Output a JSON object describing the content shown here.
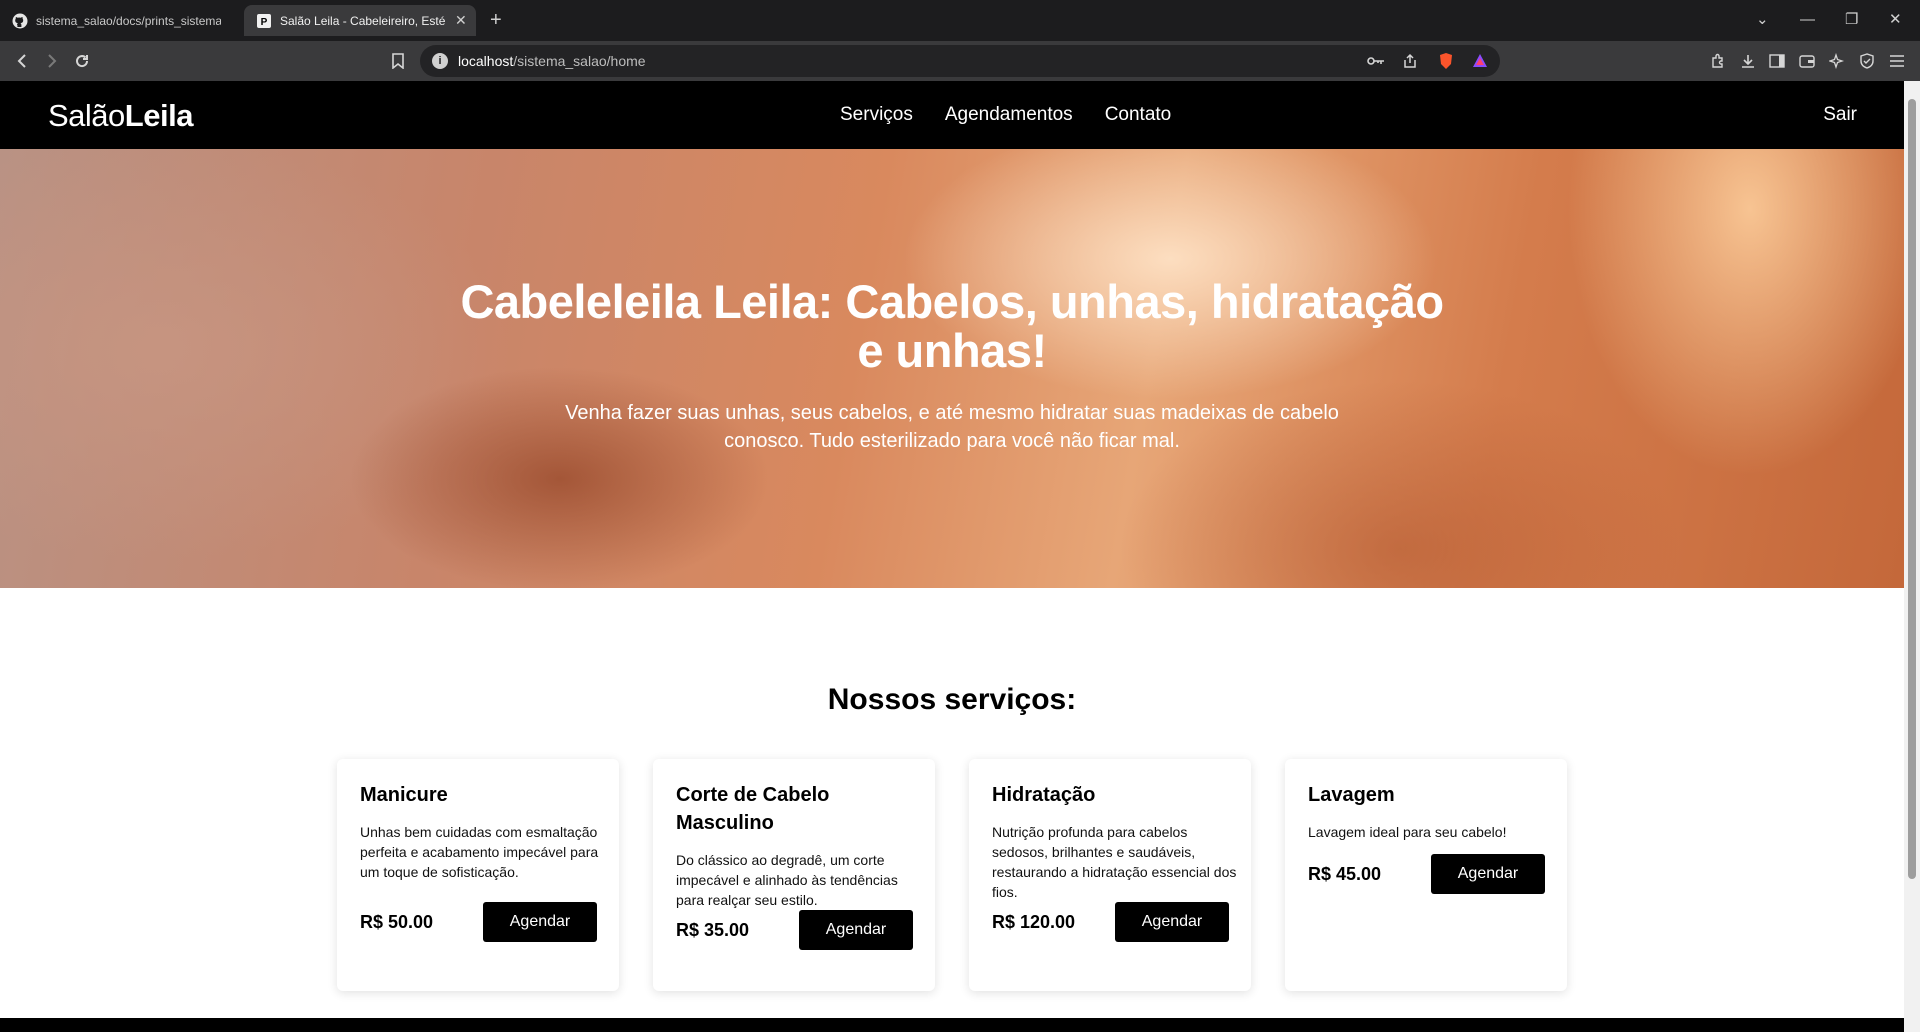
{
  "browser": {
    "tabs": [
      {
        "title": "sistema_salao/docs/prints_sistema/(",
        "active": false
      },
      {
        "title": "Salão Leila - Cabeleireiro, Estéti",
        "active": true
      }
    ],
    "new_tab_icon": "plus-icon",
    "url": {
      "host": "localhost",
      "path": "/sistema_salao/home"
    },
    "icons": [
      "back-icon",
      "forward-icon",
      "reload-icon",
      "bookmark-icon",
      "key-icon",
      "share-icon",
      "brave-shield-icon",
      "rewards-icon",
      "extensions-icon",
      "download-icon",
      "sidebar-icon",
      "wallet-icon",
      "leo-ai-icon",
      "vpn-icon",
      "menu-icon"
    ]
  },
  "site": {
    "brand": {
      "part1": "Salão",
      "part2": "Leila"
    },
    "menu": [
      "Serviços",
      "Agendamentos",
      "Contato"
    ],
    "logout": "Sair",
    "hero": {
      "title": "Cabeleleila Leila: Cabelos, unhas, hidratação e unhas!",
      "subtitle": "Venha fazer suas unhas, seus cabelos, e até mesmo hidratar suas madeixas de cabelo conosco. Tudo esterilizado para você não ficar mal."
    },
    "services_title": "Nossos serviços:",
    "services": [
      {
        "name": "Manicure",
        "description": "Unhas bem cuidadas com esmaltação perfeita e acabamento impecável para um toque de sofisticação.",
        "price": "R$ 50.00",
        "button": "Agendar"
      },
      {
        "name": "Corte de Cabelo Masculino",
        "description": "Do clássico ao degradê, um corte impecável e alinhado às tendências para realçar seu estilo.",
        "price": "R$ 35.00",
        "button": "Agendar"
      },
      {
        "name": "Hidratação",
        "description": "Nutrição profunda para cabelos sedosos, brilhantes e saudáveis, restaurando a hidratação essencial dos fios.",
        "price": "R$ 120.00",
        "button": "Agendar"
      },
      {
        "name": "Lavagem",
        "description": "Lavagem ideal para seu cabelo!",
        "price": "R$ 45.00",
        "button": "Agendar"
      }
    ]
  }
}
